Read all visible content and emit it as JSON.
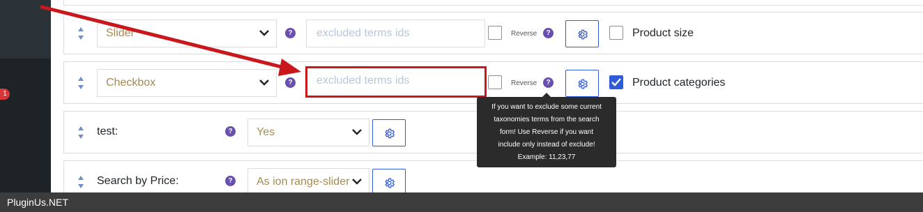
{
  "admin": {
    "update_count": "1"
  },
  "rows": [
    {
      "type_select": "Slider",
      "excluded_placeholder": "excluded terms ids",
      "reverse_label": "Reverse",
      "taxonomy_label": "Product size",
      "taxonomy_checked": false
    },
    {
      "type_select": "Checkbox",
      "excluded_placeholder": "excluded terms ids",
      "reverse_label": "Reverse",
      "taxonomy_label": "Product categories",
      "taxonomy_checked": true
    },
    {
      "label": "test:",
      "value_select": "Yes"
    },
    {
      "label": "Search by Price:",
      "value_select": "As ion range-slider"
    }
  ],
  "tooltip": {
    "lines": [
      "If you want to exclude some current",
      "taxonomies terms from the search",
      "form! Use Reverse if you want",
      "include only instead of exclude!",
      "Example: 11,23,77"
    ]
  },
  "footer": {
    "brand": "PluginUs.NET"
  },
  "colors": {
    "select_text": "#a58a52",
    "placeholder": "#b8c7d9",
    "accent_blue": "#2f5bd8",
    "help_purple": "#6a4fb3",
    "annotation_red": "#c9171c"
  },
  "icons": {
    "drag": "drag-handle-icon",
    "help": "question-icon",
    "gear": "gear-icon",
    "chevron": "chevron-down-icon",
    "check": "check-icon"
  }
}
